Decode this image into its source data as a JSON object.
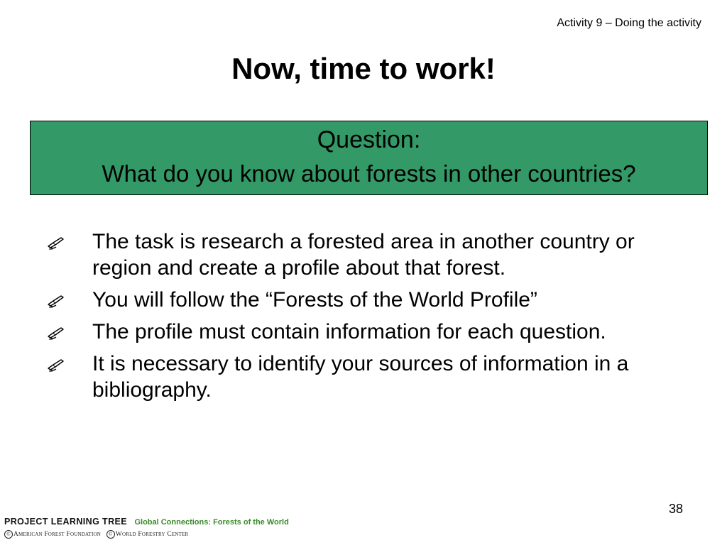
{
  "header": {
    "activity_label": "Activity 9 – Doing the activity"
  },
  "title": "Now, time to work!",
  "question_box": {
    "background_color": "#339966",
    "label": "Question:",
    "text": "What do you know about forests in other countries?"
  },
  "bullets": [
    {
      "icon": "writing-hand-icon",
      "text": "The task is research a forested area in another country or region and create a profile about that forest."
    },
    {
      "icon": "writing-hand-icon",
      "text": "You will follow the “Forests of the World Profile”"
    },
    {
      "icon": "writing-hand-icon",
      "text": "The profile must contain information for each question."
    },
    {
      "icon": "writing-hand-icon",
      "text": "It is necessary to identify your sources of information in a bibliography."
    }
  ],
  "slide_number": "38",
  "footer": {
    "program_name": "PROJECT LEARNING TREE",
    "program_subtitle": "Global Connections: Forests of the World",
    "subtitle_color": "#3a8a2a",
    "org_1": "American Forest Foundation",
    "org_2": "World Forestry Center",
    "copyright_symbol": "©"
  }
}
